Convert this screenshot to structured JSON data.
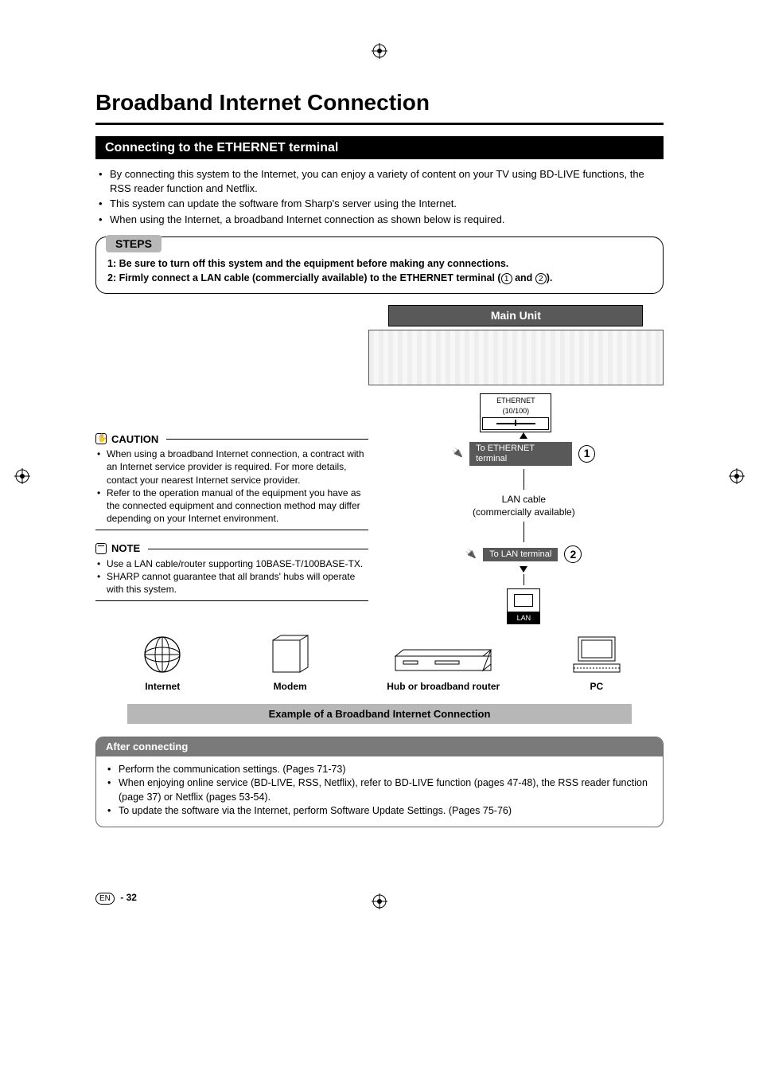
{
  "page": {
    "title": "Broadband Internet Connection",
    "number": "32",
    "lang_badge": "EN"
  },
  "section1": {
    "heading": "Connecting to the ETHERNET terminal",
    "bullets": [
      "By connecting this system to the Internet, you can enjoy a variety of content on your TV using BD-LIVE functions, the RSS reader function and Netflix.",
      "This system can update the software from Sharp's server using the Internet.",
      "When using the Internet, a broadband Internet connection as shown below is required."
    ]
  },
  "steps": {
    "tab": "STEPS",
    "line1": "1: Be sure to turn off this system and the equipment before making any connections.",
    "line2a": "2: Firmly connect a LAN cable (commercially available) to the ETHERNET terminal (",
    "line2_mid": " and ",
    "line2b": ").",
    "n1": "1",
    "n2": "2"
  },
  "caution": {
    "heading": "CAUTION",
    "items": [
      "When using a broadband Internet connection, a contract with an Internet service provider is required. For more details, contact your nearest Internet service provider.",
      "Refer to the operation manual of the equipment you have as the connected equipment and connection method may differ depending on your Internet environment."
    ]
  },
  "note": {
    "heading": "NOTE",
    "items": [
      "Use a LAN cable/router supporting 10BASE-T/100BASE-TX.",
      "SHARP cannot guarantee that all brands' hubs will operate with this system."
    ]
  },
  "diagram": {
    "main_unit": "Main Unit",
    "eth_port": "ETHERNET\n(10/100)",
    "to_eth": "To ETHERNET terminal",
    "lan_cable": "LAN cable",
    "lan_cable_sub": "(commercially available)",
    "to_lan": "To LAN terminal",
    "lan": "LAN",
    "n1": "1",
    "n2": "2",
    "devices": {
      "internet": "Internet",
      "modem": "Modem",
      "hub": "Hub or broadband router",
      "pc": "PC"
    },
    "example_caption": "Example of a Broadband Internet Connection"
  },
  "after": {
    "heading": "After connecting",
    "items": [
      "Perform the communication settings. (Pages 71-73)",
      "When enjoying online service (BD-LIVE, RSS, Netflix), refer to BD-LIVE function (pages 47-48), the RSS reader function (page 37) or Netflix (pages 53-54).",
      "To update the software via the Internet, perform Software Update Settings. (Pages 75-76)"
    ]
  }
}
